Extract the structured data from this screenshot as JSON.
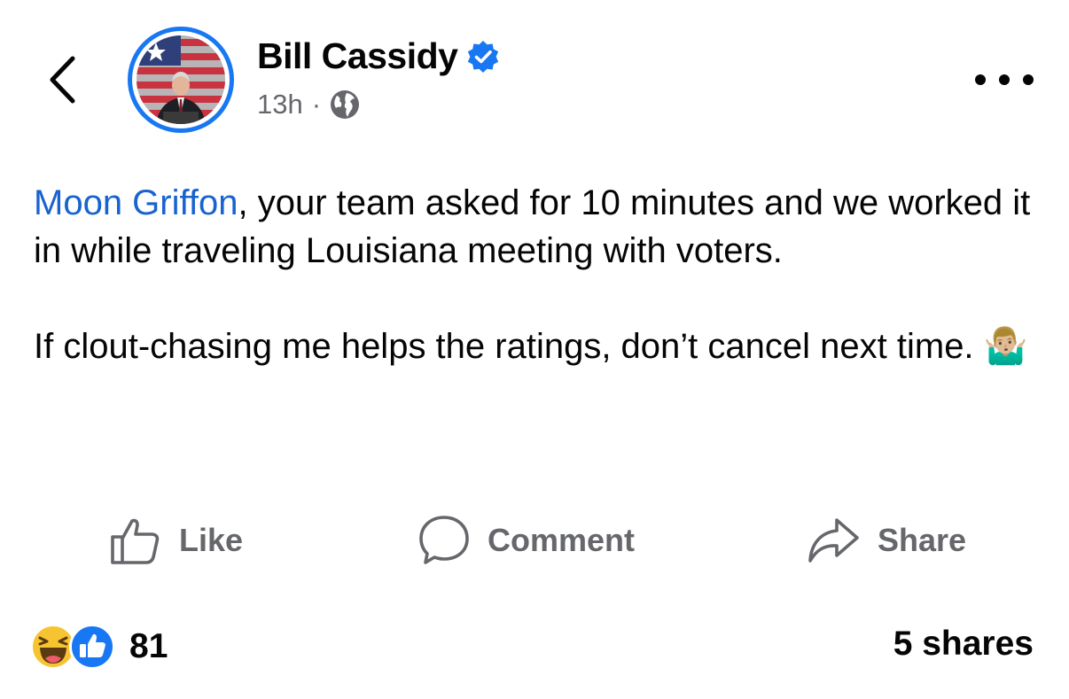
{
  "header": {
    "author_name": "Bill Cassidy",
    "verified": true,
    "timestamp": "13h",
    "separator": "·",
    "audience_icon": "globe-icon"
  },
  "post": {
    "mention": "Moon Griffon",
    "paragraph1_rest": ", your team asked for 10 minutes and we worked it in while traveling Louisiana meeting with voters.",
    "paragraph2": "If clout-chasing me helps the ratings, don’t cancel next time.",
    "emoji": "🤷🏼‍♂️"
  },
  "actions": {
    "like_label": "Like",
    "comment_label": "Comment",
    "share_label": "Share"
  },
  "footer": {
    "reaction_icons": [
      "haha-icon",
      "like-reaction-icon"
    ],
    "reaction_count": "81",
    "shares_text": "5 shares"
  },
  "colors": {
    "accent": "#1877f2",
    "mention": "#1763cf",
    "secondary_text": "#65676b",
    "primary_text": "#050505"
  }
}
